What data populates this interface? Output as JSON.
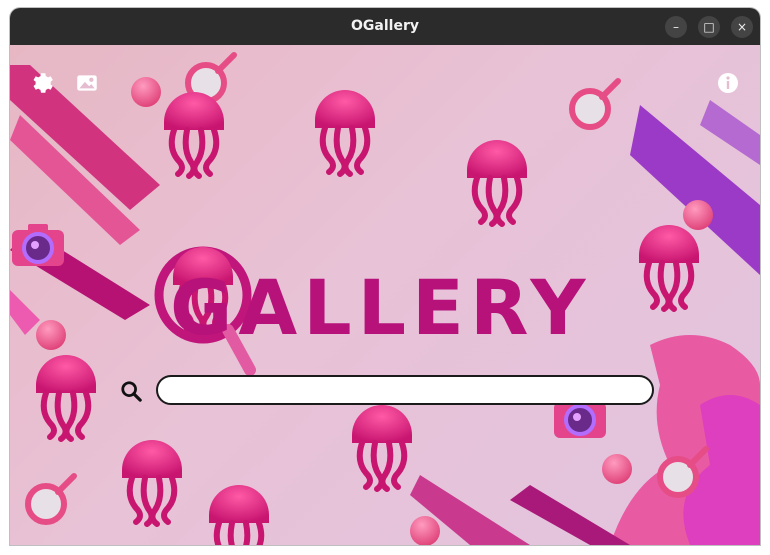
{
  "window": {
    "title": "OGallery",
    "controls": {
      "minimize": "–",
      "maximize": "□",
      "close": "×"
    }
  },
  "toolbar": {
    "settings_icon": "gear-icon",
    "gallery_icon": "image-icon",
    "info_icon": "info-icon"
  },
  "logo": {
    "text": "GALLERY",
    "mark": "magnifier-jellyfish"
  },
  "search": {
    "icon": "magnifier-icon",
    "value": "",
    "placeholder": ""
  },
  "colors": {
    "titlebar": "#2b2b2b",
    "accent": "#b6127a",
    "pink": "#e3448c",
    "magenta": "#d81b88",
    "purple": "#8e2fb5",
    "background": "#e6bcd0"
  }
}
